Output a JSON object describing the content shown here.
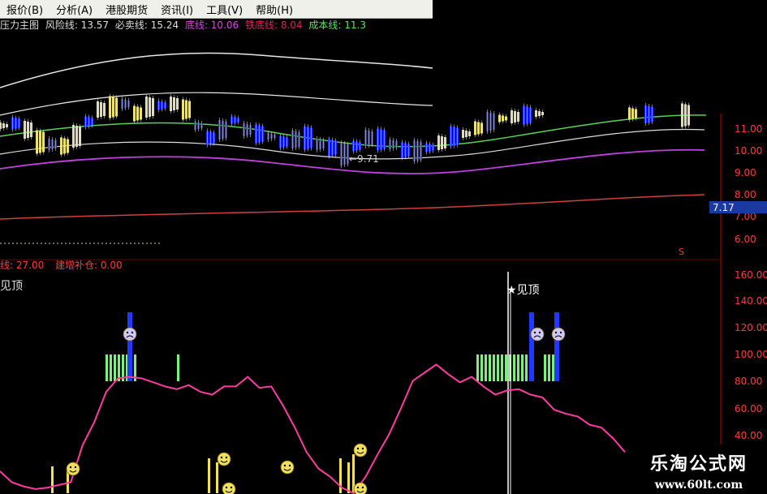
{
  "menu": [
    {
      "label": "报价(B)"
    },
    {
      "label": "分析(A)"
    },
    {
      "label": "港股期货"
    },
    {
      "label": "资讯(I)"
    },
    {
      "label": "工具(V)"
    },
    {
      "label": "帮助(H)"
    }
  ],
  "legend_top": {
    "main": "压力主图",
    "risk": "风险线: 13.57",
    "sell": "必卖线: 15.24",
    "bottom": "底线: 10.06",
    "iron": "铁底线: 8.04",
    "cost": "成本线: 11.3"
  },
  "legend_bottom": {
    "line": "线: 27.00",
    "add": "建增补仓: 0.00"
  },
  "price_marker": "←9.71",
  "price_tag": "7.17",
  "signal_label_left": "见顶",
  "signal_label_right": "★见顶",
  "colors": {
    "background": "#000000",
    "axis": "#c00000",
    "bear_candle": "#1c2cff",
    "bull_candle": "#f2e87a",
    "oscillator": "#ff3aa0",
    "green_bars": "#7cf07c",
    "blue_bars": "#2038ff"
  },
  "chart_data": {
    "type": "line",
    "upper_panel": {
      "price_axis_ticks": [
        "11.00",
        "10.00",
        "9.00",
        "8.00",
        "7.00",
        "6.00"
      ],
      "price_tag": "7.17",
      "low_marker": "9.71"
    },
    "lower_panel": {
      "axis_ticks": [
        "160.00",
        "140.00",
        "120.00",
        "100.00",
        "80.00",
        "60.00",
        "40.00"
      ],
      "oscillator": [
        16,
        8,
        5,
        3,
        4,
        6,
        8,
        35,
        52,
        74,
        84,
        85,
        84,
        81,
        78,
        76,
        79,
        74,
        72,
        78,
        78,
        85,
        77,
        78,
        64,
        48,
        30,
        18,
        12,
        4,
        0,
        12,
        28,
        43,
        62,
        82,
        88,
        94,
        87,
        81,
        85,
        78,
        72,
        75,
        76,
        72,
        70,
        61,
        58,
        56,
        50,
        48,
        40,
        30
      ]
    }
  }
}
